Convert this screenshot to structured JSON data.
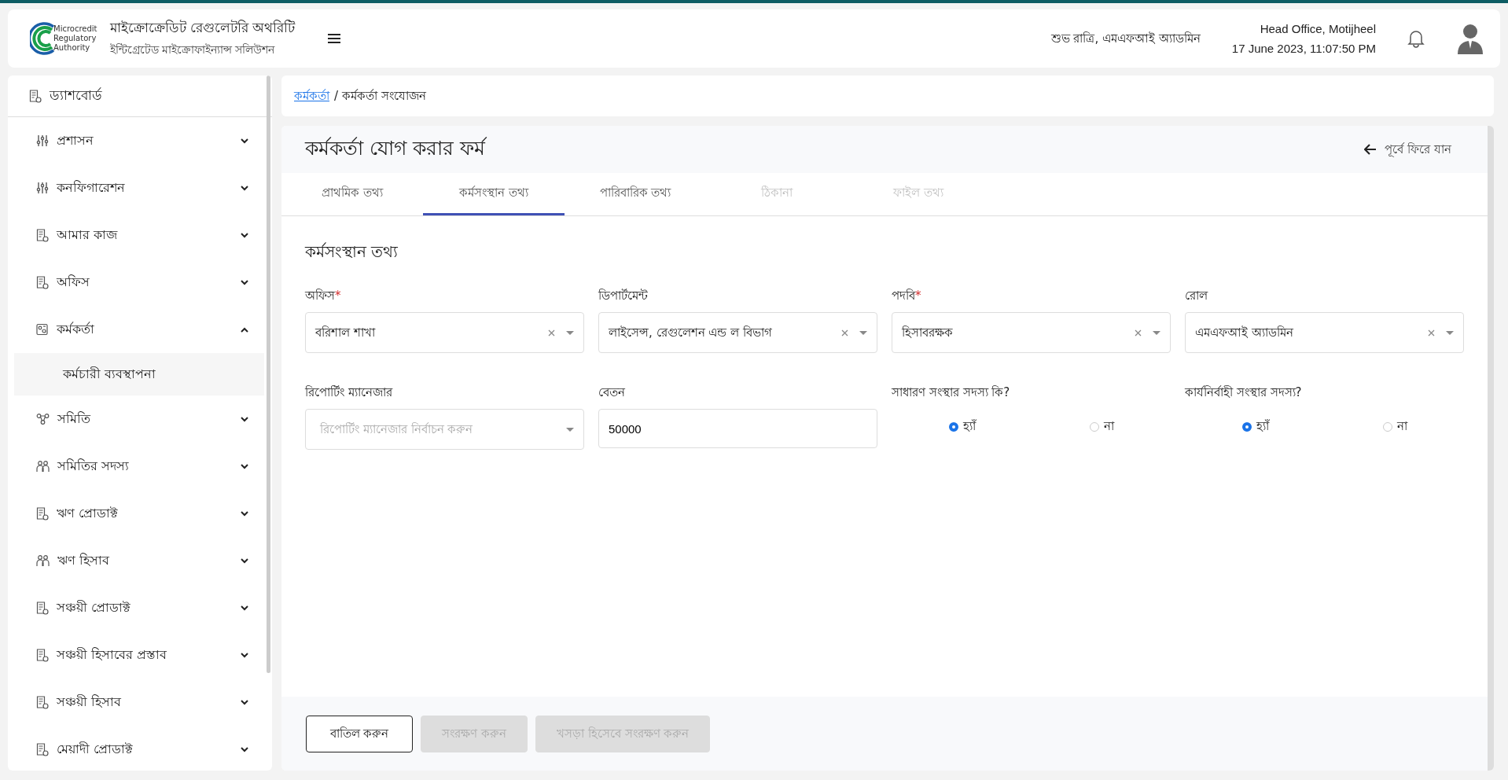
{
  "header": {
    "logo_lines": [
      "Microcredit",
      "Regulatory",
      "Authority"
    ],
    "title": "মাইক্রোক্রেডিট রেগুলেটরি অথরিটি",
    "subtitle": "ইন্টিগ্রেটেড মাইক্রোফাইন্যান্স সলিউশন",
    "greeting": "শুভ রাত্রি, এমএফআই অ্যাডমিন",
    "office": "Head Office, Motijheel",
    "datetime": "17 June 2023, 11:07:50 PM"
  },
  "sidebar": {
    "dashboard": "ড্যাশবোর্ড",
    "items": [
      {
        "label": "প্রশাসন",
        "kind": "sliders",
        "expanded": false
      },
      {
        "label": "কনফিগারেশন",
        "kind": "sliders",
        "expanded": false
      },
      {
        "label": "আমার কাজ",
        "kind": "doc",
        "expanded": false
      },
      {
        "label": "অফিস",
        "kind": "doc",
        "expanded": false
      },
      {
        "label": "কর্মকর্তা",
        "kind": "staff",
        "expanded": true,
        "children": [
          {
            "label": "কর্মচারী ব্যবস্থাপনা",
            "selected": true
          }
        ]
      },
      {
        "label": "সমিতি",
        "kind": "org",
        "expanded": false
      },
      {
        "label": "সমিতির সদস্য",
        "kind": "people",
        "expanded": false
      },
      {
        "label": "ঋণ প্রোডাক্ট",
        "kind": "doc",
        "expanded": false
      },
      {
        "label": "ঋণ হিসাব",
        "kind": "people",
        "expanded": false
      },
      {
        "label": "সঞ্চয়ী প্রোডাক্ট",
        "kind": "doc",
        "expanded": false
      },
      {
        "label": "সঞ্চয়ী হিসাবের প্রস্তাব",
        "kind": "doc",
        "expanded": false
      },
      {
        "label": "সঞ্চয়ী হিসাব",
        "kind": "doc",
        "expanded": false
      },
      {
        "label": "মেয়াদী প্রোডাক্ট",
        "kind": "doc",
        "expanded": false
      }
    ]
  },
  "breadcrumb": {
    "link": "কর্মকর্তা",
    "current": "/ কর্মকর্তা সংযোজন"
  },
  "form": {
    "title": "কর্মকর্তা যোগ করার ফর্ম",
    "back": "পূর্বে ফিরে যান",
    "tabs": [
      {
        "label": "প্রাথমিক তথ্য",
        "selected": false,
        "disabled": false
      },
      {
        "label": "কর্মসংস্থান তথ্য",
        "selected": true,
        "disabled": false
      },
      {
        "label": "পারিবারিক তথ্য",
        "selected": false,
        "disabled": false
      },
      {
        "label": "ঠিকানা",
        "selected": false,
        "disabled": true
      },
      {
        "label": "ফাইল তথ্য",
        "selected": false,
        "disabled": true
      }
    ],
    "section": "কর্মসংস্থান তথ্য",
    "fields": [
      {
        "kind": "select",
        "label": "অফিস",
        "required_mark": "*",
        "value": "বরিশাল শাখা"
      },
      {
        "kind": "select",
        "label": "ডিপার্টমেন্ট",
        "value": "লাইসেন্স, রেগুলেশন এন্ড ল বিভাগ"
      },
      {
        "kind": "select",
        "label": "পদবি",
        "required_mark": "*",
        "value": "হিসাবরক্ষক"
      },
      {
        "kind": "select",
        "label": "রোল",
        "value": "এমএফআই অ্যাডমিন"
      },
      {
        "kind": "select",
        "label": "রিপোর্টিং ম্যানেজার",
        "placeholder": "রিপোর্টিং ম্যানেজার নির্বাচন করুন"
      },
      {
        "kind": "input",
        "label": "বেতন",
        "value": "50000"
      },
      {
        "kind": "radio",
        "label": "সাধারণ সংস্থার সদস্য কি?",
        "options": [
          {
            "label": "হ্যাঁ",
            "selected": true
          },
          {
            "label": "না",
            "selected": false
          }
        ]
      },
      {
        "kind": "radio",
        "label": "কার্যনির্বাহী সংস্থার সদস্য?",
        "options": [
          {
            "label": "হ্যাঁ",
            "selected": true
          },
          {
            "label": "না",
            "selected": false
          }
        ]
      }
    ],
    "buttons": [
      {
        "label": "বাতিল করুন",
        "disabled": false
      },
      {
        "label": "সংরক্ষণ করুন",
        "disabled": true
      },
      {
        "label": "খসড়া হিসেবে সংরক্ষণ করুন",
        "disabled": true
      }
    ]
  }
}
